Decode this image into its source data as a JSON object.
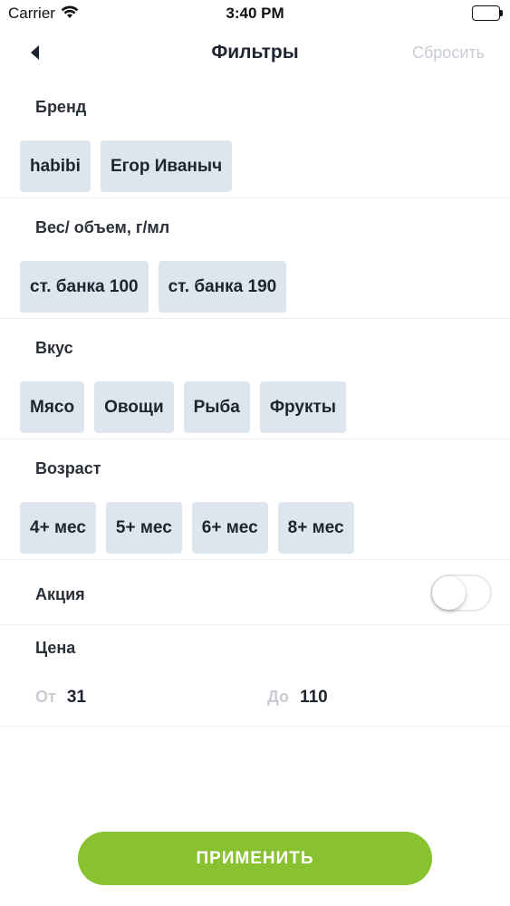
{
  "status_bar": {
    "carrier": "Carrier",
    "time": "3:40 PM"
  },
  "nav": {
    "back_icon": "chevron-left-icon",
    "title": "Фильтры",
    "reset_label": "Сбросить"
  },
  "sections": {
    "brand": {
      "title": "Бренд",
      "chips": [
        "habibi",
        "Егор Иваныч"
      ]
    },
    "weight": {
      "title": "Вес/ объем, г/мл",
      "chips": [
        "ст. банка 100",
        "ст. банка 190"
      ]
    },
    "taste": {
      "title": "Вкус",
      "chips": [
        "Мясо",
        "Овощи",
        "Рыба",
        "Фрукты"
      ]
    },
    "age": {
      "title": "Возраст",
      "chips": [
        "4+ мес",
        "5+ мес",
        "6+ мес",
        "8+ мес"
      ]
    }
  },
  "promo": {
    "title": "Акция",
    "toggle_on": false
  },
  "price": {
    "title": "Цена",
    "from_label": "От",
    "from_value": "31",
    "to_label": "До",
    "to_value": "110"
  },
  "apply_label": "ПРИМЕНИТЬ",
  "colors": {
    "accent": "#89c230",
    "chip_bg": "#dde5ee",
    "muted": "#c7ccd3"
  }
}
